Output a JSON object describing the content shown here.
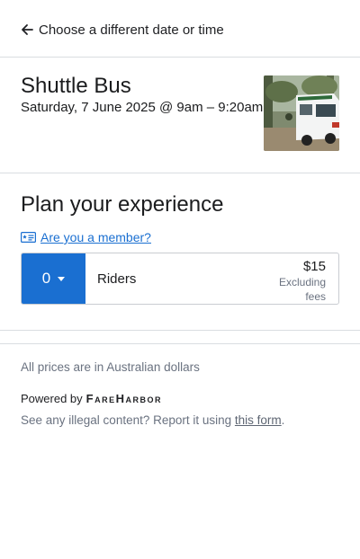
{
  "header": {
    "back_label": "Choose a different date or time"
  },
  "item": {
    "title": "Shuttle Bus",
    "datetime": "Saturday, 7 June 2025 @ 9am – 9:20am",
    "image_alt": "white shuttle van parked under trees"
  },
  "experience": {
    "title": "Plan your experience",
    "member_link": "Are you a member?"
  },
  "rate": {
    "quantity": "0",
    "label": "Riders",
    "price": "$15",
    "price_note_line1": "Excluding",
    "price_note_line2": "fees"
  },
  "footer": {
    "currency_note": "All prices are in Australian dollars",
    "powered_by": "Powered by",
    "brand": "FareHarbor",
    "report_text": "See any illegal content? Report it using ",
    "report_link": "this form",
    "report_end": "."
  },
  "colors": {
    "accent": "#1a6fd1",
    "divider": "#dadde1",
    "muted_text": "#6a7280"
  }
}
